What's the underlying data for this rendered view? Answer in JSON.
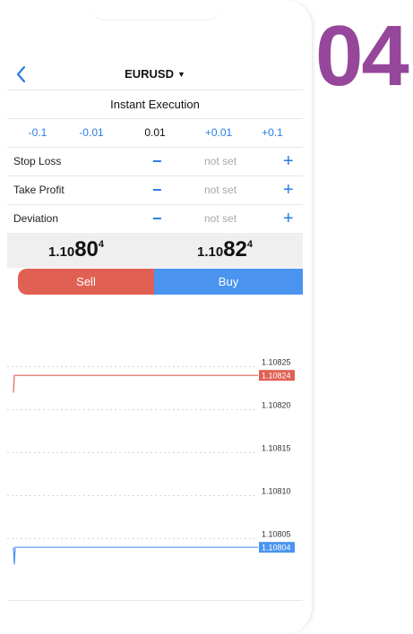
{
  "brand_number": "04",
  "header": {
    "back_icon": "chevron-left-icon",
    "symbol": "EURUSD",
    "caret": "▼"
  },
  "execution_mode": "Instant Execution",
  "volume": {
    "buttons": [
      "-0.1",
      "-0.01",
      "+0.01",
      "+0.1"
    ],
    "value": "0.01"
  },
  "params": [
    {
      "label": "Stop Loss",
      "value": "not set"
    },
    {
      "label": "Take Profit",
      "value": "not set"
    },
    {
      "label": "Deviation",
      "value": "not set"
    }
  ],
  "quotes": {
    "sell": {
      "prefix": "1.10",
      "big": "80",
      "sup": "4"
    },
    "buy": {
      "prefix": "1.10",
      "big": "82",
      "sup": "4"
    }
  },
  "actions": {
    "sell": "Sell",
    "buy": "Buy"
  },
  "colors": {
    "sell": "#e06153",
    "buy": "#4a94ef",
    "accent": "#2a7de1",
    "brand": "#96479b"
  },
  "chart_data": {
    "type": "line",
    "ylim": [
      1.10801,
      1.10826
    ],
    "ytick_labels": [
      "1.10825",
      "1.10820",
      "1.10815",
      "1.10810",
      "1.10805"
    ],
    "ask_label": "1.10824",
    "bid_label": "1.10804",
    "series": [
      {
        "values": [
          1.10822,
          1.10824,
          1.10824,
          1.10824
        ]
      },
      {
        "values": [
          1.10804,
          1.10802,
          1.10804,
          1.10804
        ]
      }
    ],
    "grid": true
  }
}
